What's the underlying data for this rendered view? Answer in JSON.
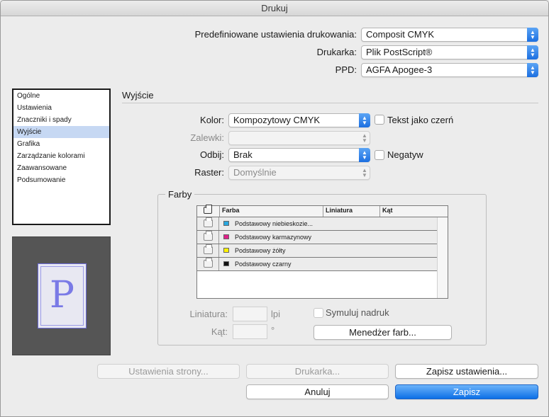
{
  "window": {
    "title": "Drukuj"
  },
  "top": {
    "preset": {
      "label": "Predefiniowane ustawienia drukowania:",
      "value": "Composit CMYK"
    },
    "printer": {
      "label": "Drukarka:",
      "value": "Plik PostScript®"
    },
    "ppd": {
      "label": "PPD:",
      "value": "AGFA Apogee-3"
    }
  },
  "sidebar": {
    "items": [
      {
        "label": "Ogólne"
      },
      {
        "label": "Ustawienia"
      },
      {
        "label": "Znaczniki i spady"
      },
      {
        "label": "Wyjście"
      },
      {
        "label": "Grafika"
      },
      {
        "label": "Zarządzanie kolorami"
      },
      {
        "label": "Zaawansowane"
      },
      {
        "label": "Podsumowanie"
      }
    ],
    "selected_index": 3
  },
  "preview": {
    "letter": "P"
  },
  "output": {
    "title": "Wyjście",
    "color": {
      "label": "Kolor:",
      "value": "Kompozytowy CMYK"
    },
    "text_as_black": {
      "label": "Tekst jako czerń",
      "checked": false
    },
    "traps": {
      "label": "Zalewki:",
      "value": ""
    },
    "flip": {
      "label": "Odbij:",
      "value": "Brak"
    },
    "negative": {
      "label": "Negatyw",
      "checked": false
    },
    "screen": {
      "label": "Raster:",
      "value": "Domyślnie"
    }
  },
  "inks": {
    "title": "Farby",
    "columns": [
      "Farba",
      "Liniatura",
      "Kąt"
    ],
    "rows": [
      {
        "name": "Podstawowy niebieskozie...",
        "color": "#29a8e0"
      },
      {
        "name": "Podstawowy karmazynowy",
        "color": "#e0218a"
      },
      {
        "name": "Podstawowy żółty",
        "color": "#fff200"
      },
      {
        "name": "Podstawowy czarny",
        "color": "#111111"
      }
    ],
    "frequency": {
      "label": "Liniatura:",
      "unit": "lpi"
    },
    "angle": {
      "label": "Kąt:",
      "unit": "°"
    },
    "simulate_overprint": {
      "label": "Symuluj nadruk",
      "checked": false
    },
    "ink_manager_label": "Menedżer farb..."
  },
  "buttons": {
    "page_setup": "Ustawienia strony...",
    "printer": "Drukarka...",
    "save_preset": "Zapisz ustawienia...",
    "cancel": "Anuluj",
    "save": "Zapisz"
  }
}
